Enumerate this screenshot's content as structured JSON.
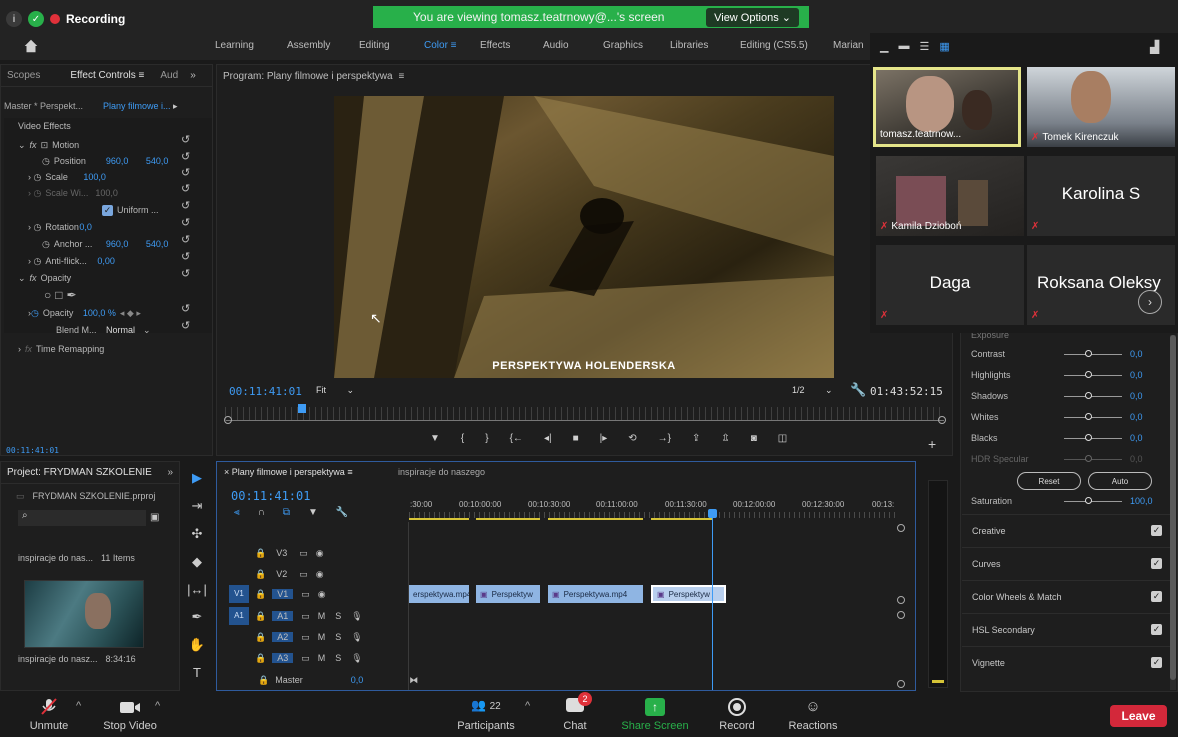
{
  "zoom_top": {
    "recording_label": "Recording",
    "viewing_banner": "You are viewing tomasz.teatrnowy@...'s screen",
    "view_options": "View Options"
  },
  "workspaces": [
    "Learning",
    "Assembly",
    "Editing",
    "Color",
    "Effects",
    "Audio",
    "Graphics",
    "Libraries",
    "Editing (CS5.5)",
    "Marian"
  ],
  "effect_controls": {
    "tabs": [
      "Scopes",
      "Effect Controls",
      "Aud"
    ],
    "master_label": "Master * Perspekt...",
    "clip_label": "Plany filmowe i...",
    "video_effects": "Video Effects",
    "rows": [
      {
        "label": "Motion",
        "v1": "",
        "v2": ""
      },
      {
        "label": "Position",
        "v1": "960,0",
        "v2": "540,0"
      },
      {
        "label": "Scale",
        "v1": "100,0",
        "v2": ""
      },
      {
        "label": "Scale Wi...",
        "v1": "100,0",
        "v2": ""
      },
      {
        "label": "Uniform ...",
        "v1": "",
        "v2": ""
      },
      {
        "label": "Rotation",
        "v1": "0,0",
        "v2": ""
      },
      {
        "label": "Anchor ...",
        "v1": "960,0",
        "v2": "540,0"
      },
      {
        "label": "Anti-flick...",
        "v1": "0,00",
        "v2": ""
      },
      {
        "label": "Opacity",
        "v1": "",
        "v2": ""
      },
      {
        "label": "Opacity",
        "v1": "100,0 %",
        "v2": ""
      },
      {
        "label": "Blend M...",
        "v1": "Normal",
        "v2": ""
      },
      {
        "label": "Time Remapping",
        "v1": "",
        "v2": ""
      }
    ],
    "timecode": "00:11:41:01"
  },
  "program": {
    "title": "Program: Plany filmowe i perspektywa",
    "caption": "PERSPEKTYWA HOLENDERSKA",
    "timecode": "00:11:41:01",
    "fit": "Fit",
    "resolution": "1/2",
    "duration": "01:43:52:15"
  },
  "project": {
    "title": "Project: FRYDMAN SZKOLENIE",
    "file": "FRYDMAN SZKOLENIE.prproj",
    "bin_name": "inspiracje do nas...",
    "bin_count": "11 Items",
    "clip_name": "inspiracje do nasz...",
    "clip_duration": "8:34:16"
  },
  "timeline": {
    "tab1": "Plany filmowe i perspektywa",
    "tab2": "inspiracje do naszego",
    "timecode": "00:11:41:01",
    "ruler": [
      ":30:00",
      "00:10:00:00",
      "00:10:30:00",
      "00:11:00:00",
      "00:11:30:00",
      "00:12:00:00",
      "00:12:30:00",
      "00:13:"
    ],
    "tracks": [
      "V3",
      "V2",
      "V1",
      "A1",
      "A2",
      "A3"
    ],
    "master_label": "Master",
    "master_value": "0,0",
    "clips": [
      "erspektywa.mp4",
      "Perspektyw",
      "Perspektywa.mp4",
      "Perspektyw"
    ]
  },
  "lumetri": {
    "exposure": "Exposure",
    "rows": [
      {
        "label": "Contrast",
        "value": "0,0"
      },
      {
        "label": "Highlights",
        "value": "0,0"
      },
      {
        "label": "Shadows",
        "value": "0,0"
      },
      {
        "label": "Whites",
        "value": "0,0"
      },
      {
        "label": "Blacks",
        "value": "0,0"
      },
      {
        "label": "HDR Specular",
        "value": "0,0"
      }
    ],
    "reset": "Reset",
    "auto": "Auto",
    "saturation": "Saturation",
    "saturation_value": "100,0",
    "sections": [
      "Creative",
      "Curves",
      "Color Wheels & Match",
      "HSL Secondary",
      "Vignette"
    ]
  },
  "participants_tiles": [
    {
      "name": "tomasz.teatrnow..."
    },
    {
      "name": "Tomek Kirenczuk"
    },
    {
      "name": "Kamila Dzioboń"
    },
    {
      "name": "Karolina S"
    },
    {
      "name": "Daga"
    },
    {
      "name": "Roksana Oleksy"
    }
  ],
  "zoom_bar": {
    "unmute": "Unmute",
    "stop_video": "Stop Video",
    "participants": "Participants",
    "participants_count": "22",
    "chat": "Chat",
    "chat_badge": "2",
    "share_screen": "Share Screen",
    "record": "Record",
    "reactions": "Reactions",
    "leave": "Leave"
  },
  "colors": {
    "accent": "#3e9bf4",
    "zoom_green": "#28b04a",
    "leave_red": "#d3283a",
    "speaker_highlight": "#e5e58a"
  }
}
